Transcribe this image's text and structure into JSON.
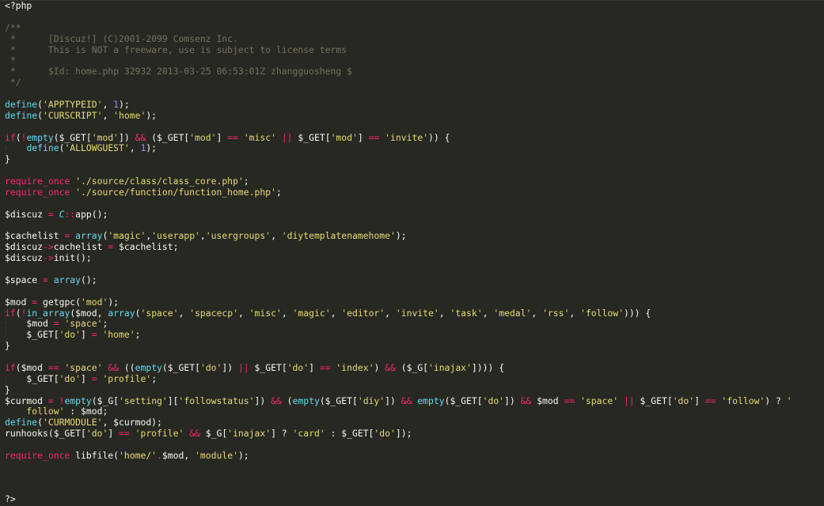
{
  "editor": {
    "language": "php",
    "theme_colors": {
      "background": "#272822",
      "text": "#f8f8f2",
      "comment": "#75715e",
      "keyword": "#f92672",
      "function": "#66d9ef",
      "string": "#e6db74",
      "number": "#ae81ff"
    },
    "lines": [
      [
        [
          "p",
          "<?php"
        ]
      ],
      [],
      [
        [
          "c",
          "/**"
        ]
      ],
      [
        [
          "c",
          " *      [Discuz!] (C)2001-2099 Comsenz Inc."
        ]
      ],
      [
        [
          "c",
          " *      This is NOT a freeware, use is subject to license terms"
        ]
      ],
      [
        [
          "c",
          " *"
        ]
      ],
      [
        [
          "c",
          " *      $Id: home.php 32932 2013-03-25 06:53:01Z zhangguosheng $"
        ]
      ],
      [
        [
          "c",
          " */"
        ]
      ],
      [],
      [
        [
          "f",
          "define"
        ],
        [
          "p",
          "("
        ],
        [
          "s",
          "'APPTYPEID'"
        ],
        [
          "p",
          ", "
        ],
        [
          "n",
          "1"
        ],
        [
          "p",
          ");"
        ]
      ],
      [
        [
          "f",
          "define"
        ],
        [
          "p",
          "("
        ],
        [
          "s",
          "'CURSCRIPT'"
        ],
        [
          "p",
          ", "
        ],
        [
          "s",
          "'home'"
        ],
        [
          "p",
          ");"
        ]
      ],
      [],
      [
        [
          "k",
          "if"
        ],
        [
          "p",
          "("
        ],
        [
          "k",
          "!"
        ],
        [
          "f",
          "empty"
        ],
        [
          "p",
          "($_GET["
        ],
        [
          "s",
          "'mod'"
        ],
        [
          "p",
          "]) "
        ],
        [
          "k",
          "&&"
        ],
        [
          "p",
          " ($_GET["
        ],
        [
          "s",
          "'mod'"
        ],
        [
          "p",
          "] "
        ],
        [
          "k",
          "=="
        ],
        [
          "p",
          " "
        ],
        [
          "s",
          "'misc'"
        ],
        [
          "p",
          " "
        ],
        [
          "k",
          "||"
        ],
        [
          "p",
          " $_GET["
        ],
        [
          "s",
          "'mod'"
        ],
        [
          "p",
          "] "
        ],
        [
          "k",
          "=="
        ],
        [
          "p",
          " "
        ],
        [
          "s",
          "'invite'"
        ],
        [
          "p",
          ")) {"
        ]
      ],
      [
        [
          "p",
          "    "
        ],
        [
          "f",
          "define"
        ],
        [
          "p",
          "("
        ],
        [
          "s",
          "'ALLOWGUEST'"
        ],
        [
          "p",
          ", "
        ],
        [
          "n",
          "1"
        ],
        [
          "p",
          ");"
        ]
      ],
      [
        [
          "p",
          "}"
        ]
      ],
      [],
      [
        [
          "k",
          "require_once"
        ],
        [
          "p",
          " "
        ],
        [
          "s",
          "'./source/class/class_core.php'"
        ],
        [
          "p",
          ";"
        ]
      ],
      [
        [
          "k",
          "require_once"
        ],
        [
          "p",
          " "
        ],
        [
          "s",
          "'./source/function/function_home.php'"
        ],
        [
          "p",
          ";"
        ]
      ],
      [],
      [
        [
          "p",
          "$discuz "
        ],
        [
          "k",
          "="
        ],
        [
          "p",
          " "
        ],
        [
          "cls",
          "C"
        ],
        [
          "k",
          "::"
        ],
        [
          "p",
          "app();"
        ]
      ],
      [],
      [
        [
          "p",
          "$cachelist "
        ],
        [
          "k",
          "="
        ],
        [
          "p",
          " "
        ],
        [
          "f",
          "array"
        ],
        [
          "p",
          "("
        ],
        [
          "s",
          "'magic'"
        ],
        [
          "p",
          ","
        ],
        [
          "s",
          "'userapp'"
        ],
        [
          "p",
          ","
        ],
        [
          "s",
          "'usergroups'"
        ],
        [
          "p",
          ", "
        ],
        [
          "s",
          "'diytemplatenamehome'"
        ],
        [
          "p",
          ");"
        ]
      ],
      [
        [
          "p",
          "$discuz"
        ],
        [
          "k",
          "->"
        ],
        [
          "p",
          "cachelist "
        ],
        [
          "k",
          "="
        ],
        [
          "p",
          " $cachelist;"
        ]
      ],
      [
        [
          "p",
          "$discuz"
        ],
        [
          "k",
          "->"
        ],
        [
          "p",
          "init();"
        ]
      ],
      [],
      [
        [
          "p",
          "$space "
        ],
        [
          "k",
          "="
        ],
        [
          "p",
          " "
        ],
        [
          "f",
          "array"
        ],
        [
          "p",
          "();"
        ]
      ],
      [],
      [
        [
          "p",
          "$mod "
        ],
        [
          "k",
          "="
        ],
        [
          "p",
          " getgpc("
        ],
        [
          "s",
          "'mod'"
        ],
        [
          "p",
          ");"
        ]
      ],
      [
        [
          "k",
          "if"
        ],
        [
          "p",
          "("
        ],
        [
          "k",
          "!"
        ],
        [
          "f",
          "in_array"
        ],
        [
          "p",
          "($mod, "
        ],
        [
          "f",
          "array"
        ],
        [
          "p",
          "("
        ],
        [
          "s",
          "'space'"
        ],
        [
          "p",
          ", "
        ],
        [
          "s",
          "'spacecp'"
        ],
        [
          "p",
          ", "
        ],
        [
          "s",
          "'misc'"
        ],
        [
          "p",
          ", "
        ],
        [
          "s",
          "'magic'"
        ],
        [
          "p",
          ", "
        ],
        [
          "s",
          "'editor'"
        ],
        [
          "p",
          ", "
        ],
        [
          "s",
          "'invite'"
        ],
        [
          "p",
          ", "
        ],
        [
          "s",
          "'task'"
        ],
        [
          "p",
          ", "
        ],
        [
          "s",
          "'medal'"
        ],
        [
          "p",
          ", "
        ],
        [
          "s",
          "'rss'"
        ],
        [
          "p",
          ", "
        ],
        [
          "s",
          "'follow'"
        ],
        [
          "p",
          "))) {"
        ]
      ],
      [
        [
          "p",
          "    $mod "
        ],
        [
          "k",
          "="
        ],
        [
          "p",
          " "
        ],
        [
          "s",
          "'space'"
        ],
        [
          "p",
          ";"
        ]
      ],
      [
        [
          "p",
          "    $_GET["
        ],
        [
          "s",
          "'do'"
        ],
        [
          "p",
          "] "
        ],
        [
          "k",
          "="
        ],
        [
          "p",
          " "
        ],
        [
          "s",
          "'home'"
        ],
        [
          "p",
          ";"
        ]
      ],
      [
        [
          "p",
          "}"
        ]
      ],
      [],
      [
        [
          "k",
          "if"
        ],
        [
          "p",
          "($mod "
        ],
        [
          "k",
          "=="
        ],
        [
          "p",
          " "
        ],
        [
          "s",
          "'space'"
        ],
        [
          "p",
          " "
        ],
        [
          "k",
          "&&"
        ],
        [
          "p",
          " (("
        ],
        [
          "f",
          "empty"
        ],
        [
          "p",
          "($_GET["
        ],
        [
          "s",
          "'do'"
        ],
        [
          "p",
          "]) "
        ],
        [
          "k",
          "||"
        ],
        [
          "p",
          " $_GET["
        ],
        [
          "s",
          "'do'"
        ],
        [
          "p",
          "] "
        ],
        [
          "k",
          "=="
        ],
        [
          "p",
          " "
        ],
        [
          "s",
          "'index'"
        ],
        [
          "p",
          ") "
        ],
        [
          "k",
          "&&"
        ],
        [
          "p",
          " ($_G["
        ],
        [
          "s",
          "'inajax'"
        ],
        [
          "p",
          "]))) {"
        ]
      ],
      [
        [
          "p",
          "    $_GET["
        ],
        [
          "s",
          "'do'"
        ],
        [
          "p",
          "] "
        ],
        [
          "k",
          "="
        ],
        [
          "p",
          " "
        ],
        [
          "s",
          "'profile'"
        ],
        [
          "p",
          ";"
        ]
      ],
      [
        [
          "p",
          "}"
        ]
      ],
      [
        [
          "p",
          "$curmod "
        ],
        [
          "k",
          "="
        ],
        [
          "p",
          " "
        ],
        [
          "k",
          "!"
        ],
        [
          "f",
          "empty"
        ],
        [
          "p",
          "($_G["
        ],
        [
          "s",
          "'setting'"
        ],
        [
          "p",
          "]["
        ],
        [
          "s",
          "'followstatus'"
        ],
        [
          "p",
          "]) "
        ],
        [
          "k",
          "&&"
        ],
        [
          "p",
          " ("
        ],
        [
          "f",
          "empty"
        ],
        [
          "p",
          "($_GET["
        ],
        [
          "s",
          "'diy'"
        ],
        [
          "p",
          "]) "
        ],
        [
          "k",
          "&&"
        ],
        [
          "p",
          " "
        ],
        [
          "f",
          "empty"
        ],
        [
          "p",
          "($_GET["
        ],
        [
          "s",
          "'do'"
        ],
        [
          "p",
          "]) "
        ],
        [
          "k",
          "&&"
        ],
        [
          "p",
          " $mod "
        ],
        [
          "k",
          "=="
        ],
        [
          "p",
          " "
        ],
        [
          "s",
          "'space'"
        ],
        [
          "p",
          " "
        ],
        [
          "k",
          "||"
        ],
        [
          "p",
          " $_GET["
        ],
        [
          "s",
          "'do'"
        ],
        [
          "p",
          "] "
        ],
        [
          "k",
          "=="
        ],
        [
          "p",
          " "
        ],
        [
          "s",
          "'follow'"
        ],
        [
          "p",
          ") ? "
        ],
        [
          "s",
          "'"
        ]
      ],
      [
        [
          "s",
          "    follow'"
        ],
        [
          "p",
          " : $mod;"
        ]
      ],
      [
        [
          "f",
          "define"
        ],
        [
          "p",
          "("
        ],
        [
          "s",
          "'CURMODULE'"
        ],
        [
          "p",
          ", $curmod);"
        ]
      ],
      [
        [
          "p",
          "runhooks($_GET["
        ],
        [
          "s",
          "'do'"
        ],
        [
          "p",
          "] "
        ],
        [
          "k",
          "=="
        ],
        [
          "p",
          " "
        ],
        [
          "s",
          "'profile'"
        ],
        [
          "p",
          " "
        ],
        [
          "k",
          "&&"
        ],
        [
          "p",
          " $_G["
        ],
        [
          "s",
          "'inajax'"
        ],
        [
          "p",
          "] ? "
        ],
        [
          "s",
          "'card'"
        ],
        [
          "p",
          " : $_GET["
        ],
        [
          "s",
          "'do'"
        ],
        [
          "p",
          "]);"
        ]
      ],
      [],
      [
        [
          "k",
          "require_once"
        ],
        [
          "p",
          " libfile("
        ],
        [
          "s",
          "'home/'"
        ],
        [
          "k",
          "."
        ],
        [
          "p",
          "$mod, "
        ],
        [
          "s",
          "'module'"
        ],
        [
          "p",
          ");"
        ]
      ],
      [],
      [],
      [],
      [
        [
          "p",
          "?>"
        ]
      ]
    ]
  }
}
